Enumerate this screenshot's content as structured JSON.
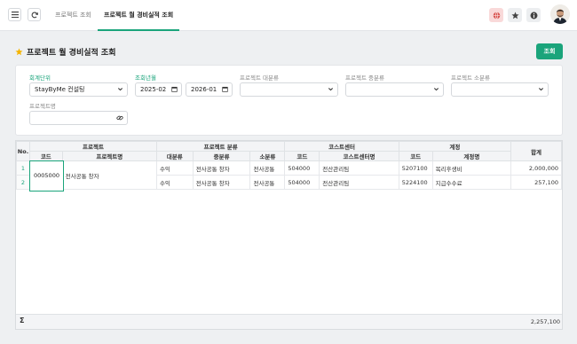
{
  "nav": {
    "tabs": [
      {
        "label": "프로젝트 조회"
      },
      {
        "label": "프로젝트 월 경비실적 조회"
      }
    ]
  },
  "page": {
    "title": "프로젝트 월 경비실적 조회",
    "search_button": "조회"
  },
  "filters": {
    "unit_label": "회계단위",
    "unit_value": "StayByMe 컨설팅",
    "period_label": "조회년월",
    "period_from": "2025-02",
    "period_to": "2026-01",
    "major_label": "프로젝트 대분류",
    "mid_label": "프로젝트 중분류",
    "minor_label": "프로젝트 소분류",
    "name_label": "프로젝트명",
    "name_value": ""
  },
  "grid": {
    "group_headers": {
      "no": "No.",
      "project": "프로젝트",
      "category": "프로젝트 분류",
      "cost_center": "코스트센터",
      "account": "계정",
      "total": "합계"
    },
    "sub_headers": {
      "code": "코드",
      "project_name": "프로젝트명",
      "major": "대분류",
      "mid": "중분류",
      "minor": "소분류",
      "cc_code": "코드",
      "cc_name": "코스트센터명",
      "acc_code": "코드",
      "acc_name": "계정명"
    },
    "rows": [
      {
        "no": "1",
        "code": "0005000",
        "name": "전사공통 창자",
        "major": "수익",
        "mid": "전사공통 창자",
        "minor": "전사공통",
        "cc_code": "504000",
        "cc_name": "전산관리팀",
        "acc_code": "5207100",
        "acc_name": "복리후생비",
        "total": "2,000,000"
      },
      {
        "no": "2",
        "code": "",
        "name": "",
        "major": "수익",
        "mid": "전사공통 창자",
        "minor": "전사공통",
        "cc_code": "504000",
        "cc_name": "전산관리팀",
        "acc_code": "5224100",
        "acc_name": "지급수수료",
        "total": "257,100"
      }
    ],
    "sum_symbol": "Σ",
    "sum_total": "2,257,100"
  }
}
